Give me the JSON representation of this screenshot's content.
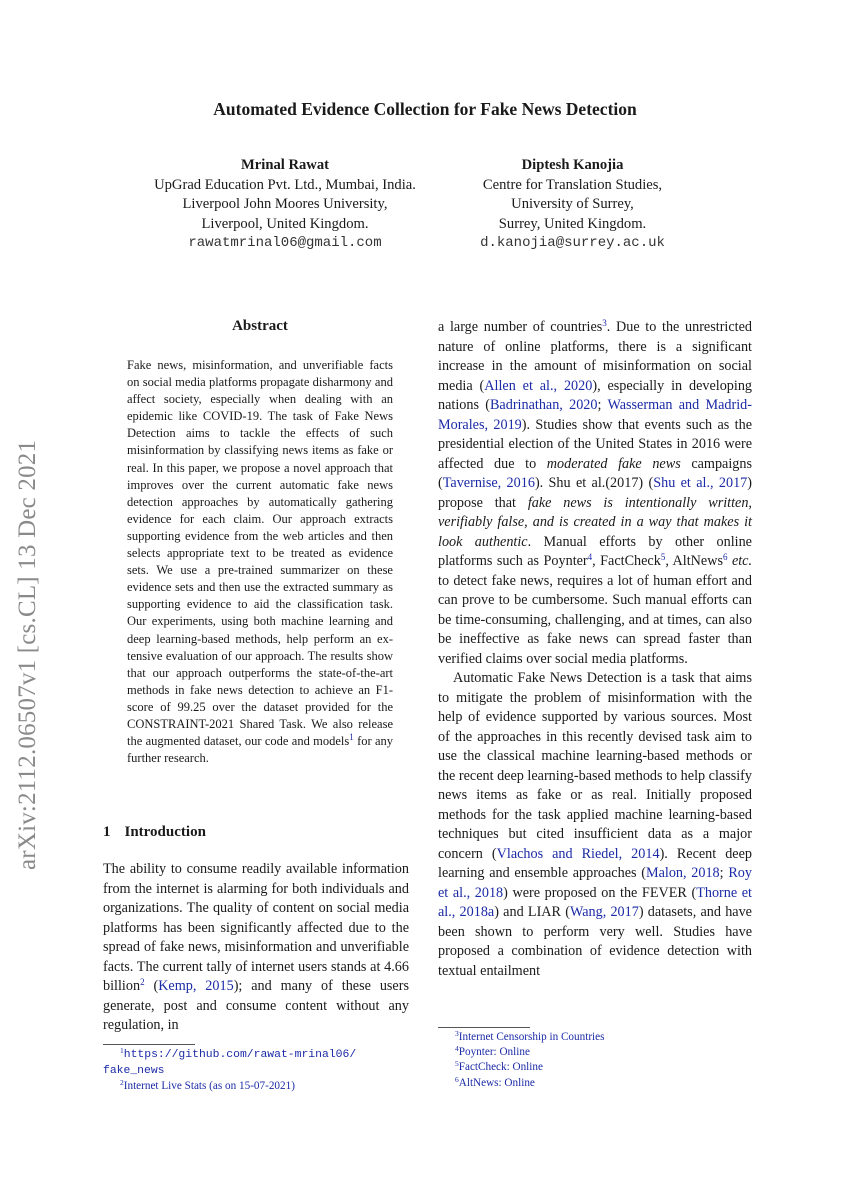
{
  "sidebar_stamp": "arXiv:2112.06507v1  [cs.CL]  13 Dec 2021",
  "title": "Automated Evidence Collection for Fake News Detection",
  "authors": [
    {
      "name": "Mrinal Rawat",
      "affiliation_lines": [
        "UpGrad Education Pvt. Ltd., Mumbai, India.",
        "Liverpool John Moores University,",
        "Liverpool, United Kingdom."
      ],
      "email": "rawatmrinal06@gmail.com"
    },
    {
      "name": "Diptesh Kanojia",
      "affiliation_lines": [
        "Centre for Translation Studies,",
        "University of Surrey,",
        "Surrey, United Kingdom."
      ],
      "email": "d.kanojia@surrey.ac.uk"
    }
  ],
  "abstract": {
    "heading": "Abstract",
    "text_before_fn": "Fake news, misinformation, and unverifi­able facts on social media platforms propa­gate disharmony and affect society, especially when dealing with an epidemic like COVID-19. The task of Fake News Detection aims to tackle the effects of such misinformation by classifying news items as fake or real. In this paper, we propose a novel approach that im­proves over the current automatic fake news detection approaches by automatically gather­ing evidence for each claim. Our approach extracts supporting evidence from the web ar­ticles and then selects appropriate text to be treated as evidence sets. We use a pre-trained summarizer on these evidence sets and then use the extracted summary as supporting evi­dence to aid the classification task. Our exper­iments, using both machine learning and deep learning-based methods, help perform an ex­tensive evaluation of our approach. The results show that our approach outperforms the state-of-the-art methods in fake news detection to achieve an F1-score of 99.25 over the dataset provided for the CONSTRAINT-2021 Shared Task. We also release the augmented dataset, our code and models",
    "fn_mark": "1",
    "text_after_fn": " for any further research."
  },
  "section": {
    "number": "1",
    "title": "Introduction"
  },
  "intro_col1": {
    "t1": "The ability to consume readily available informa­tion from the internet is alarming for both indi­viduals and organizations. The quality of content on social media platforms has been significantly affected due to the spread of fake news, misinfor­mation and unverifiable facts. The current tally of internet users stands at 4.66 billion",
    "fn2": "2",
    "t2": " (",
    "cite_kemp": "Kemp, 2015",
    "t3": "); and many of these users generate, post and consume content without any regulation, in"
  },
  "intro_col2": {
    "t1": "a large number of countries",
    "fn3": "3",
    "t2": ". Due to the unre­stricted nature of online platforms, there is a sig­nificant increase in the amount of misinformation on social media (",
    "cite_allen": "Allen et al., 2020",
    "t3": "), especially in developing nations (",
    "cite_badri": "Badrinathan, 2020",
    "t4": "; ",
    "cite_wasser": "Wasser­man and Madrid-Morales, 2019",
    "t5": "). Studies show that events such as the presidential election of the United States in 2016 were affected due to ",
    "em1": "moder­ated fake news",
    "t6": " campaigns (",
    "cite_tav": "Tavernise, 2016",
    "t7": "). Shu et al.(2017) (",
    "cite_shu": "Shu et al., 2017",
    "t8": ") propose that ",
    "em2": "fake news is intentionally written, verifiably false, and is created in a way that makes it look authentic",
    "t9": ". Manual efforts by other online platforms such as Poynter",
    "fn4": "4",
    "t10": ", FactCheck",
    "fn5": "5",
    "t11": ", AltNews",
    "fn6": "6",
    "t12": " ",
    "em3": "etc.",
    "t13": " to detect fake news, requires a lot of human effort and can prove to be cumbersome. Such manual efforts can be time-consuming, challenging, and at times, can also be ineffective as fake news can spread faster than verified claims over social media platforms.",
    "p2_t1": "Automatic Fake News Detection is a task that aims to mitigate the problem of misinformation with the help of evidence supported by various sources. Most of the approaches in this recently devised task aim to use the classical machine learning-based methods or the recent deep learning-based methods to help classify news items as fake or as real. Initially proposed methods for the task applied machine learning-based techniques but cited insufficient data as a major concern (",
    "cite_vlachos": "Vlachos and Riedel, 2014",
    "p2_t2": "). Recent deep learning and ensemble approaches (",
    "cite_malon": "Malon, 2018",
    "p2_t3": "; ",
    "cite_roy": "Roy et al., 2018",
    "p2_t4": ") were proposed on the FEVER (",
    "cite_thorne": "Thorne et al., 2018a",
    "p2_t5": ") and LIAR (",
    "cite_wang": "Wang, 2017",
    "p2_t6": ") datasets, and have been shown to perform very well. Studies have proposed a combination of evidence detection with textual entailment"
  },
  "footnotes_left": [
    {
      "mark": "1",
      "text_a": "https://github.com/rawat-mrinal06/",
      "text_b": "fake_news"
    },
    {
      "mark": "2",
      "text": "Internet Live Stats (as on 15-07-2021)"
    }
  ],
  "footnotes_right": [
    {
      "mark": "3",
      "text": "Internet Censorship in Countries"
    },
    {
      "mark": "4",
      "text": "Poynter: Online"
    },
    {
      "mark": "5",
      "text": "FactCheck: Online"
    },
    {
      "mark": "6",
      "text": "AltNews: Online"
    }
  ],
  "colors": {
    "link": "#1b2aa6",
    "stamp": "#8a8a8a"
  }
}
